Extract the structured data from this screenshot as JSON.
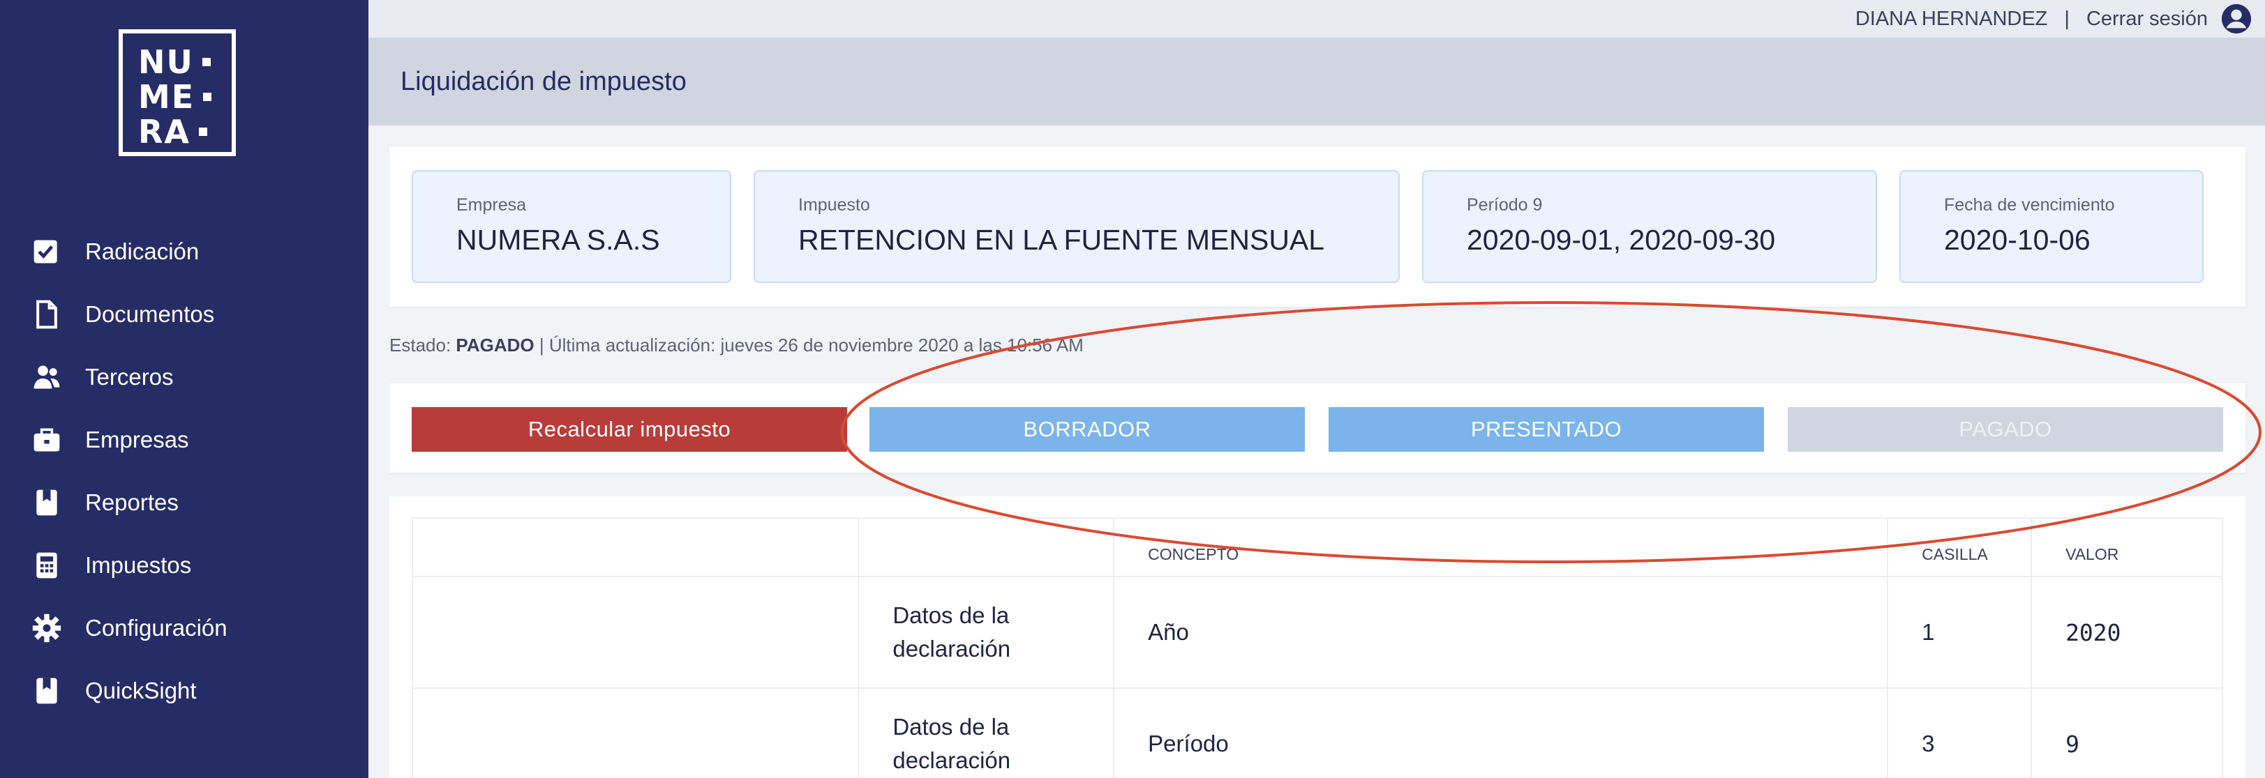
{
  "sidebar": {
    "logo": {
      "line1": "NU",
      "line2": "ME",
      "line3": "RA"
    },
    "items": [
      {
        "label": "Radicación",
        "icon": "checkbox-icon"
      },
      {
        "label": "Documentos",
        "icon": "document-icon"
      },
      {
        "label": "Terceros",
        "icon": "users-icon"
      },
      {
        "label": "Empresas",
        "icon": "briefcase-icon"
      },
      {
        "label": "Reportes",
        "icon": "bookmark-book-icon"
      },
      {
        "label": "Impuestos",
        "icon": "calculator-icon"
      },
      {
        "label": "Configuración",
        "icon": "gear-icon"
      },
      {
        "label": "QuickSight",
        "icon": "bookmark-book-icon"
      }
    ]
  },
  "topbar": {
    "user_name": "DIANA HERNANDEZ",
    "separator": "|",
    "logout_label": "Cerrar sesión",
    "user_icon": "user-avatar-icon"
  },
  "header": {
    "title": "Liquidación de impuesto"
  },
  "info": {
    "empresa": {
      "label": "Empresa",
      "value": "NUMERA S.A.S"
    },
    "impuesto": {
      "label": "Impuesto",
      "value": "RETENCION EN LA FUENTE MENSUAL"
    },
    "periodo": {
      "label": "Período 9",
      "value": "2020-09-01, 2020-09-30"
    },
    "vencimiento": {
      "label": "Fecha de vencimiento",
      "value": "2020-10-06"
    }
  },
  "estado": {
    "prefix": "Estado:",
    "value": "PAGADO",
    "separator": "|",
    "updated": "Última actualización: jueves 26 de noviembre 2020 a las 10:56 AM"
  },
  "actions": {
    "recalcular": "Recalcular impuesto",
    "borrador": "BORRADOR",
    "presentado": "PRESENTADO",
    "pagado": "PAGADO"
  },
  "table": {
    "headers": {
      "col1": "",
      "col2": "",
      "concepto": "CONCEPTO",
      "casilla": "CASILLA",
      "valor": "VALOR"
    },
    "rows": [
      {
        "grupo": "Datos de la declaración",
        "concepto": "Año",
        "casilla": "1",
        "valor": "2020"
      },
      {
        "grupo": "Datos de la declaración",
        "concepto": "Período",
        "casilla": "3",
        "valor": "9"
      }
    ]
  },
  "colors": {
    "sidebar": "#262c65",
    "recalcular": "#b83c3a",
    "state_active": "#7ab4ea",
    "state_inactive": "#d0d6df",
    "annotation": "#d94a32"
  }
}
